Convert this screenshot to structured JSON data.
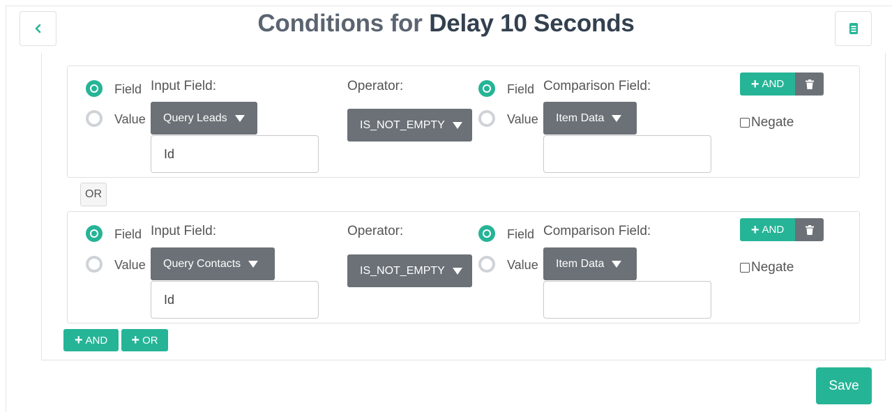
{
  "header": {
    "title_prefix": "Conditions for",
    "title_subject": "Delay 10 Seconds",
    "back_icon": "chevron-left-icon",
    "report_icon": "document-icon"
  },
  "labels": {
    "field_option": "Field",
    "value_option": "Value",
    "input_field": "Input Field:",
    "operator": "Operator:",
    "comparison_field": "Comparison Field:",
    "and_button": "AND",
    "negate": "Negate",
    "or_separator": "OR",
    "add_and": "AND",
    "add_or": "OR",
    "save": "Save"
  },
  "conditions": [
    {
      "input_mode": "Field",
      "input_source": "Query Leads",
      "input_value": "Id",
      "operator": "IS_NOT_EMPTY",
      "comparison_mode": "Field",
      "comparison_source": "Item Data",
      "comparison_value": "",
      "negate": false
    },
    {
      "input_mode": "Field",
      "input_source": "Query Contacts",
      "input_value": "Id",
      "operator": "IS_NOT_EMPTY",
      "comparison_mode": "Field",
      "comparison_source": "Item Data",
      "comparison_value": "",
      "negate": false
    }
  ],
  "colors": {
    "accent": "#26b497",
    "dropdown": "#6b7177",
    "title_prefix": "#5b6470",
    "title_subject": "#33404f"
  }
}
